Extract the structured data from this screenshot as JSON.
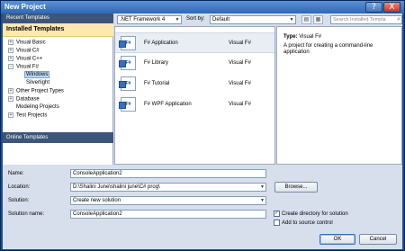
{
  "window": {
    "title": "New Project",
    "help_glyph": "?",
    "close_glyph": "X"
  },
  "left_pane": {
    "recent_templates": "Recent Templates",
    "installed_templates": "Installed Templates",
    "online_templates": "Online Templates",
    "tree": [
      {
        "label": "Visual Basic",
        "expander": "+"
      },
      {
        "label": "Visual C#",
        "expander": "+"
      },
      {
        "label": "Visual C++",
        "expander": "+"
      },
      {
        "label": "Visual F#",
        "expander": "−"
      },
      {
        "label": "Windows",
        "expander": ""
      },
      {
        "label": "Silverlight",
        "expander": ""
      },
      {
        "label": "Other Project Types",
        "expander": "+"
      },
      {
        "label": "Database",
        "expander": "+"
      },
      {
        "label": "Modeling Projects",
        "expander": ""
      },
      {
        "label": "Test Projects",
        "expander": "+"
      }
    ]
  },
  "toolbar": {
    "framework": ".NET Framework 4",
    "sort_label": "Sort by:",
    "sort_value": "Default",
    "search_placeholder": "Search Installed Templa"
  },
  "templates": [
    {
      "name": "F# Application",
      "language": "Visual F#",
      "icon": "F#"
    },
    {
      "name": "F# Library",
      "language": "Visual F#",
      "icon": "F#"
    },
    {
      "name": "F# Tutorial",
      "language": "Visual F#",
      "icon": "F#"
    },
    {
      "name": "F# WPF Application",
      "language": "Visual F#",
      "icon": "F#"
    }
  ],
  "description": {
    "type_label": "Type:",
    "type_value": "Visual F#",
    "text": "A project for creating a command-line application"
  },
  "form": {
    "name_label": "Name:",
    "name_value": "ConsoleApplication2",
    "location_label": "Location:",
    "location_value": "D:\\Shalini June\\shalini june\\C# prog\\",
    "solution_label": "Solution:",
    "solution_value": "Create new solution",
    "solution_name_label": "Solution name:",
    "solution_name_value": "ConsoleApplication2",
    "browse_label": "Browse...",
    "create_dir_label": "Create directory for solution",
    "create_dir_checked": "✓",
    "source_control_label": "Add to source control",
    "ok_label": "OK",
    "cancel_label": "Cancel"
  },
  "colors": {
    "accent": "#2f68b7",
    "selected_category": "#fde8b0",
    "header_band": "#3d5578"
  }
}
